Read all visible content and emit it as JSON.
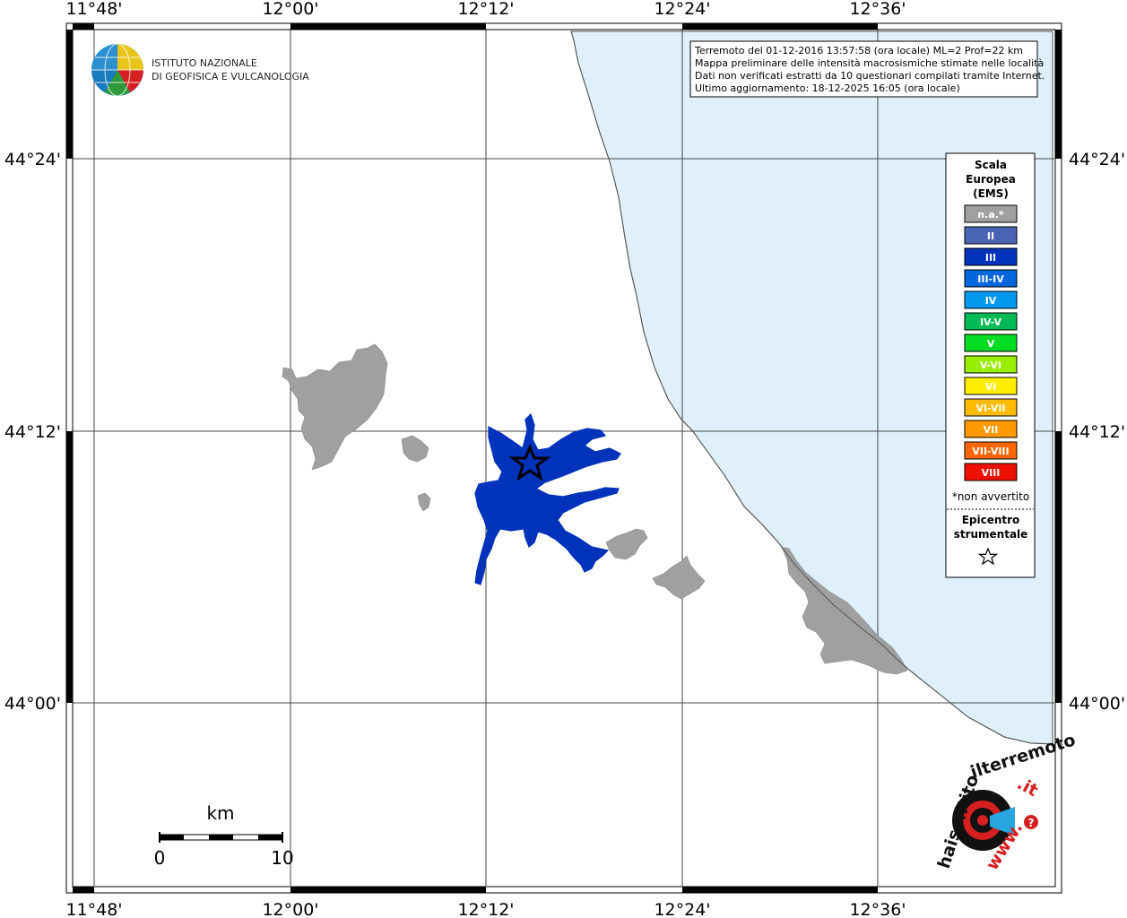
{
  "map": {
    "lon_ticks": [
      "11°48'",
      "12°00'",
      "12°12'",
      "12°24'",
      "12°36'"
    ],
    "lat_ticks": [
      "44°24'",
      "44°12'",
      "44°00'"
    ]
  },
  "logo": {
    "line1": "ISTITUTO NAZIONALE",
    "line2": "DI GEOFISICA E VULCANOLOGIA"
  },
  "info_box": {
    "line1": "Terremoto del 01-12-2016 13:57:58 (ora locale) ML=2 Prof=22 km",
    "line2": "Mappa preliminare delle intensità macrosismiche stimate nelle località",
    "line3": "Dati non verificati estratti da 10 questionari compilati tramite Internet.",
    "line4": "Ultimo aggiornamento: 18-12-2025 16:05 (ora locale)"
  },
  "legend": {
    "title1": "Scala",
    "title2": "Europea",
    "title3": "(EMS)",
    "items": [
      {
        "label": "n.a.*",
        "color": "#a0a0a0"
      },
      {
        "label": "II",
        "color": "#4a64b4"
      },
      {
        "label": "III",
        "color": "#0033bb"
      },
      {
        "label": "III-IV",
        "color": "#0066dd"
      },
      {
        "label": "IV",
        "color": "#0099ee"
      },
      {
        "label": "IV-V",
        "color": "#00bb55"
      },
      {
        "label": "V",
        "color": "#00dd22"
      },
      {
        "label": "V-VI",
        "color": "#99ee00"
      },
      {
        "label": "VI",
        "color": "#ffee00"
      },
      {
        "label": "VI-VII",
        "color": "#ffbb00"
      },
      {
        "label": "VII",
        "color": "#ff9900"
      },
      {
        "label": "VII-VIII",
        "color": "#ff6600"
      },
      {
        "label": "VIII",
        "color": "#ee1100"
      }
    ],
    "note": "*non avvertito",
    "epicenter1": "Epicentro",
    "epicenter2": "strumentale"
  },
  "scale_bar": {
    "unit": "km",
    "min": "0",
    "max": "10"
  },
  "site_logo": {
    "text1": "www.",
    "text2": "haisentito",
    "text3": "ilterremoto",
    "text4": ".it"
  },
  "colors": {
    "sea": "#dff0fb",
    "land_na": "#a0a0a0",
    "intensity_iii": "#0033bb"
  }
}
